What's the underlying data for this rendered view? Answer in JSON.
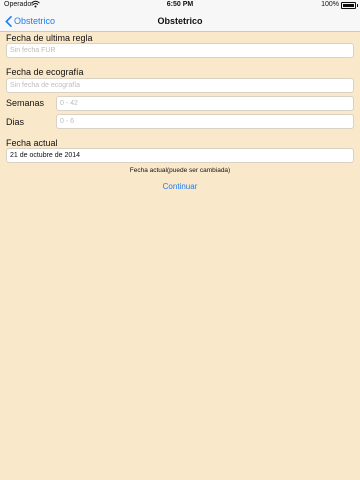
{
  "status_bar": {
    "carrier": "Operador",
    "time": "6:50 PM",
    "battery": "100%"
  },
  "nav": {
    "back_label": "Obstetrico",
    "title": "Obstetrico"
  },
  "form": {
    "fur_label": "Fecha de ultima regla",
    "fur_placeholder": "Sin fecha FUR",
    "eco_label": "Fecha de ecografía",
    "eco_placeholder": "Sin fecha de ecografía",
    "semanas_label": "Semanas",
    "semanas_placeholder": "0 - 42",
    "dias_label": "Dias",
    "dias_placeholder": "0 - 6",
    "actual_label": "Fecha actual",
    "actual_value": "21 de octubre de 2014",
    "hint": "Fecha actual(puede ser cambiada)",
    "continue_label": "Continuar"
  },
  "colors": {
    "background": "#fae8ca",
    "accent": "#1a7ef5"
  }
}
